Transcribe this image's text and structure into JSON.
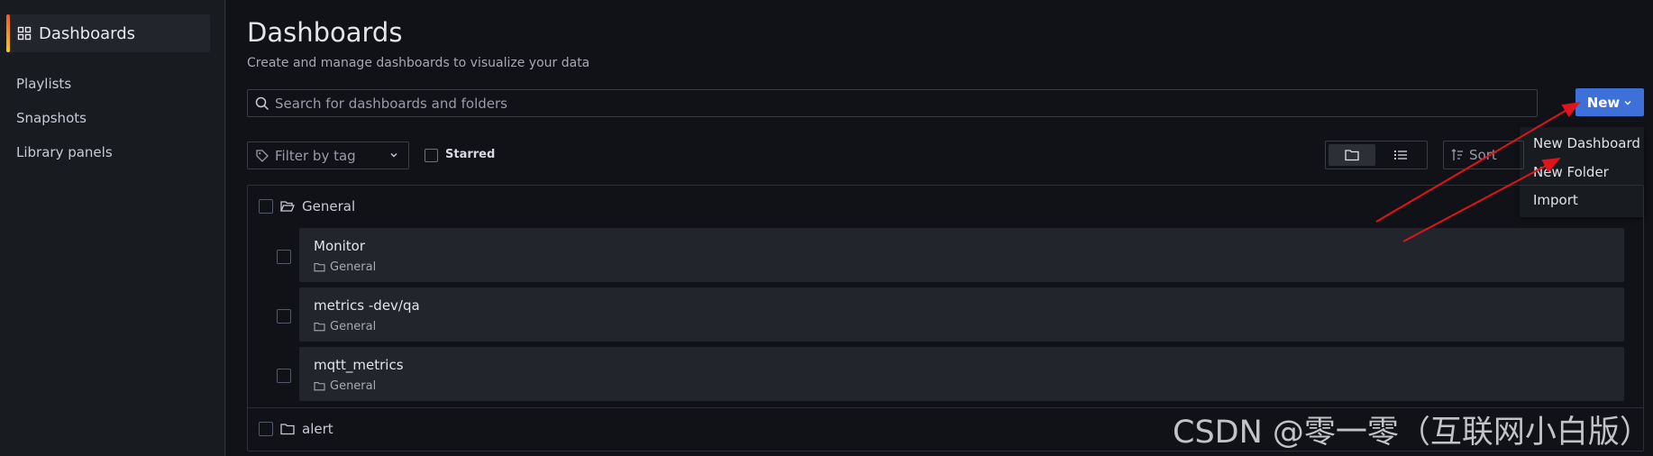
{
  "sidebar": {
    "title": "Dashboards",
    "items": [
      {
        "label": "Playlists"
      },
      {
        "label": "Snapshots"
      },
      {
        "label": "Library panels"
      }
    ]
  },
  "header": {
    "title": "Dashboards",
    "subtitle": "Create and manage dashboards to visualize your data"
  },
  "search": {
    "placeholder": "Search for dashboards and folders"
  },
  "new_button": {
    "label": "New"
  },
  "new_menu": {
    "items": [
      {
        "label": "New Dashboard"
      },
      {
        "label": "New Folder"
      },
      {
        "label": "Import"
      }
    ]
  },
  "filters": {
    "tag_placeholder": "Filter by tag",
    "starred_label": "Starred",
    "sort_label": "Sort"
  },
  "folders": [
    {
      "name": "General",
      "dashboards": [
        {
          "title": "Monitor",
          "folder": "General"
        },
        {
          "title": "metrics -dev/qa",
          "folder": "General"
        },
        {
          "title": "mqtt_metrics",
          "folder": "General"
        }
      ]
    },
    {
      "name": "alert"
    }
  ],
  "watermark": "CSDN @零一零（互联网小白版）",
  "colors": {
    "accent": "#3d71d9",
    "background": "#111217",
    "card": "#22252b",
    "annotation_arrow": "#e0141a"
  }
}
